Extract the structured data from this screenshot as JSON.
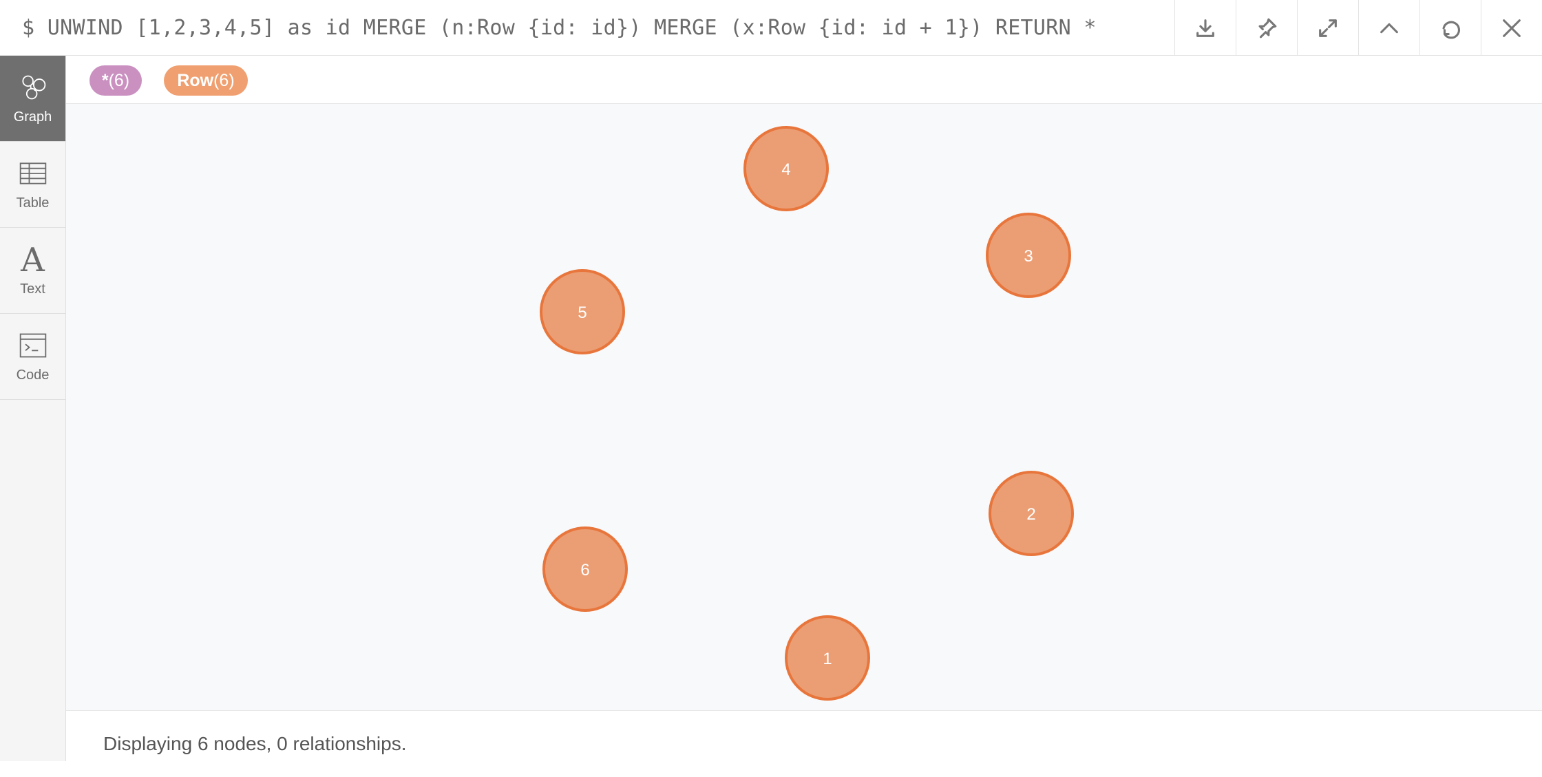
{
  "query": {
    "text": "$ UNWIND [1,2,3,4,5] as id MERGE (n:Row {id: id}) MERGE (x:Row {id: id + 1}) RETURN *"
  },
  "toolbar": {
    "icons": [
      "download-icon",
      "pin-icon",
      "expand-icon",
      "collapse-icon",
      "rerun-icon",
      "close-icon"
    ]
  },
  "sidebar": {
    "items": [
      {
        "label": "Graph",
        "icon": "graph-icon",
        "active": true
      },
      {
        "label": "Table",
        "icon": "table-icon",
        "active": false
      },
      {
        "label": "Text",
        "icon": "text-icon",
        "active": false
      },
      {
        "label": "Code",
        "icon": "code-icon",
        "active": false
      }
    ]
  },
  "legend": {
    "all": {
      "label": "*",
      "count": "(6)",
      "color": "#c990c0"
    },
    "row": {
      "label": "Row",
      "count": "(6)",
      "color": "#f0a070"
    }
  },
  "graph": {
    "node_fill": "#eb9e74",
    "node_stroke": "#e8763c",
    "nodes": [
      {
        "label": "4"
      },
      {
        "label": "3"
      },
      {
        "label": "5"
      },
      {
        "label": "2"
      },
      {
        "label": "6"
      },
      {
        "label": "1"
      }
    ]
  },
  "status": {
    "text": "Displaying 6 nodes, 0 relationships."
  }
}
